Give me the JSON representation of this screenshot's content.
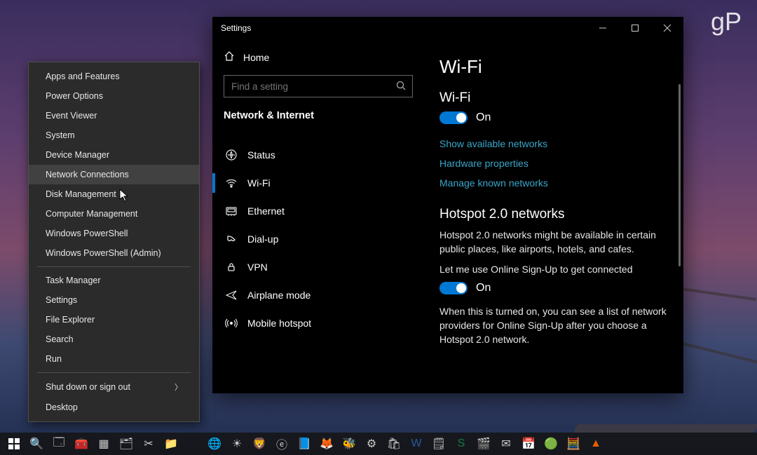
{
  "watermark": "gP",
  "context_menu": {
    "items_group1": [
      "Apps and Features",
      "Power Options",
      "Event Viewer",
      "System",
      "Device Manager",
      "Network Connections",
      "Disk Management",
      "Computer Management",
      "Windows PowerShell",
      "Windows PowerShell (Admin)"
    ],
    "items_group2": [
      "Task Manager",
      "Settings",
      "File Explorer",
      "Search",
      "Run"
    ],
    "items_group3": [
      "Shut down or sign out",
      "Desktop"
    ],
    "hovered_index": 5
  },
  "settings_window": {
    "title": "Settings",
    "home_label": "Home",
    "search_placeholder": "Find a setting",
    "category": "Network & Internet",
    "nav_items": [
      {
        "icon": "status-icon",
        "label": "Status"
      },
      {
        "icon": "wifi-icon",
        "label": "Wi-Fi",
        "selected": true
      },
      {
        "icon": "ethernet-icon",
        "label": "Ethernet"
      },
      {
        "icon": "dialup-icon",
        "label": "Dial-up"
      },
      {
        "icon": "vpn-icon",
        "label": "VPN"
      },
      {
        "icon": "airplane-icon",
        "label": "Airplane mode"
      },
      {
        "icon": "hotspot-icon",
        "label": "Mobile hotspot"
      }
    ],
    "content": {
      "page_title": "Wi-Fi",
      "wifi_section_title": "Wi-Fi",
      "wifi_toggle_value": "On",
      "link_show_networks": "Show available networks",
      "link_hw_props": "Hardware properties",
      "link_manage": "Manage known networks",
      "hotspot_section_title": "Hotspot 2.0 networks",
      "hotspot_desc": "Hotspot 2.0 networks might be available in certain public places, like airports, hotels, and cafes.",
      "hotspot_toggle_label": "Let me use Online Sign-Up to get connected",
      "hotspot_toggle_value": "On",
      "hotspot_footnote": "When this is turned on, you can see a list of network providers for Online Sign-Up after you choose a Hotspot 2.0 network."
    }
  }
}
